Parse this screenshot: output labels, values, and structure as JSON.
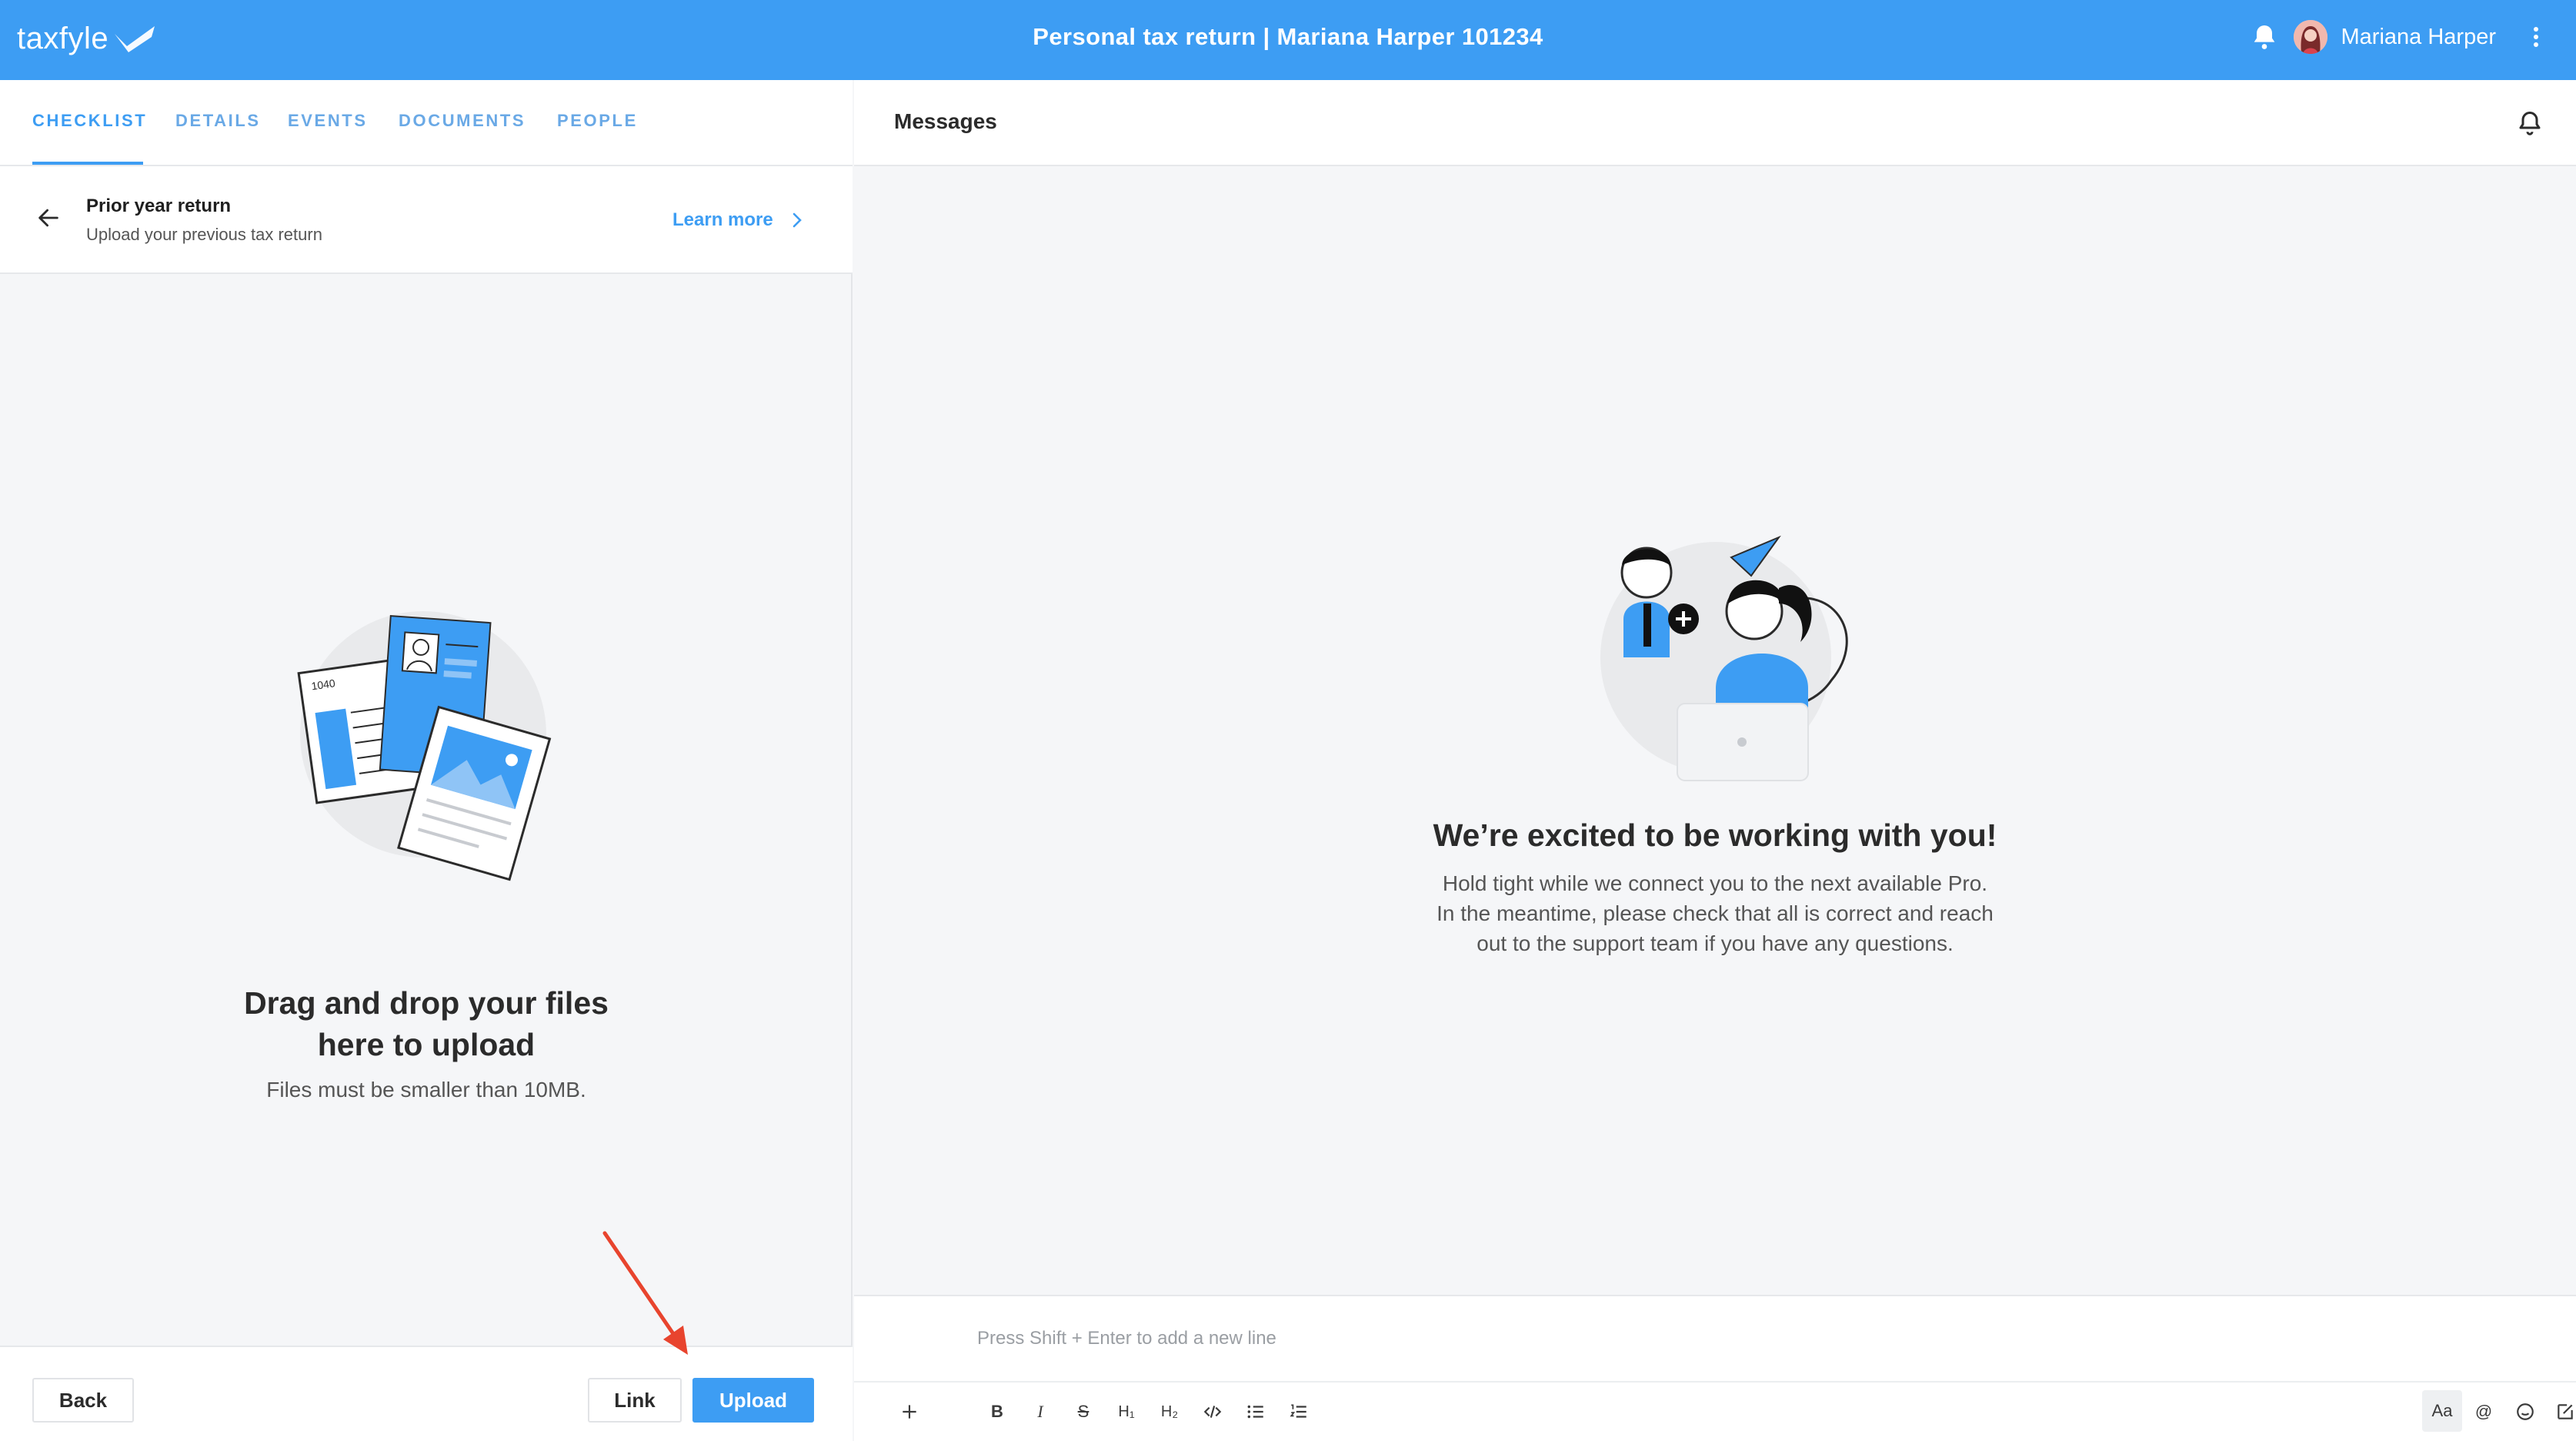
{
  "app": {
    "logo_text": "taxfyle",
    "title": "Personal tax return | Mariana Harper 101234",
    "user_name": "Mariana Harper"
  },
  "tabs": [
    {
      "label": "CHECKLIST",
      "active": true
    },
    {
      "label": "DETAILS",
      "active": false
    },
    {
      "label": "EVENTS",
      "active": false
    },
    {
      "label": "DOCUMENTS",
      "active": false
    },
    {
      "label": "PEOPLE",
      "active": false
    }
  ],
  "checklist_item": {
    "title": "Prior year return",
    "subtitle": "Upload your previous tax return",
    "learn_more": "Learn more"
  },
  "dropzone": {
    "title_line1": "Drag and drop your files",
    "title_line2": "here to upload",
    "subtitle": "Files must be smaller than 10MB.",
    "illustration_form_label": "1040"
  },
  "footer": {
    "back": "Back",
    "link": "Link",
    "upload": "Upload"
  },
  "messages": {
    "title": "Messages",
    "welcome_title": "We’re excited to be working with you!",
    "welcome_line1": "Hold tight while we connect you to the next available Pro.",
    "welcome_line2": "In the meantime, please check that all is correct and reach",
    "welcome_line3": "out to the support team if you have any questions.",
    "composer_placeholder": "Press Shift + Enter to add a new line"
  },
  "toolbar": {
    "bold": "B",
    "italic": "I",
    "strike": "S",
    "h1": "H₁",
    "h2": "H₂",
    "text_style": "Aa",
    "mention": "@"
  },
  "colors": {
    "brand": "#3d9df3",
    "annotation_arrow": "#e8442e"
  },
  "icons": [
    "bell-icon",
    "avatar",
    "kebab-icon",
    "arrow-left-icon",
    "chevron-right-icon",
    "plus-icon",
    "code-icon",
    "bullet-list-icon",
    "numbered-list-icon",
    "emoji-icon",
    "compose-icon"
  ]
}
